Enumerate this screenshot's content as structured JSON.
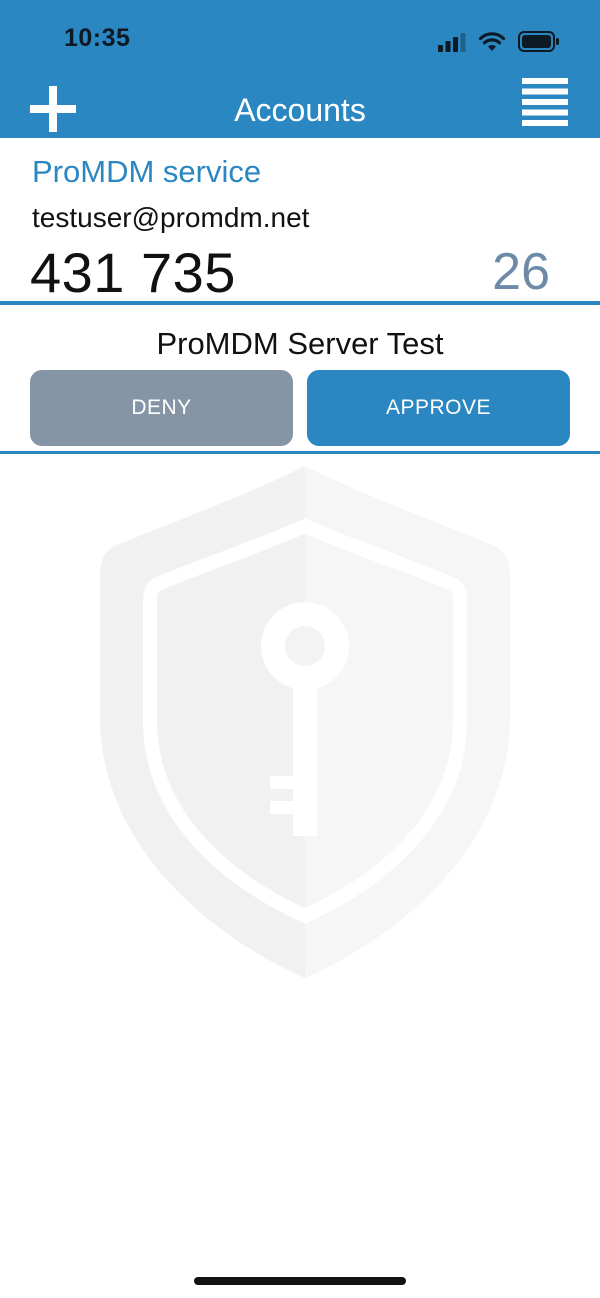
{
  "status_bar": {
    "time": "10:35"
  },
  "nav": {
    "title": "Accounts"
  },
  "account": {
    "service": "ProMDM service",
    "user": "testuser@promdm.net",
    "code": "431 735",
    "timer": "26"
  },
  "request": {
    "title": "ProMDM Server Test",
    "deny_label": "DENY",
    "approve_label": "APPROVE"
  },
  "colors": {
    "accent": "#2a87c1",
    "deny": "#8595a6",
    "timer": "#6d8aa7"
  }
}
